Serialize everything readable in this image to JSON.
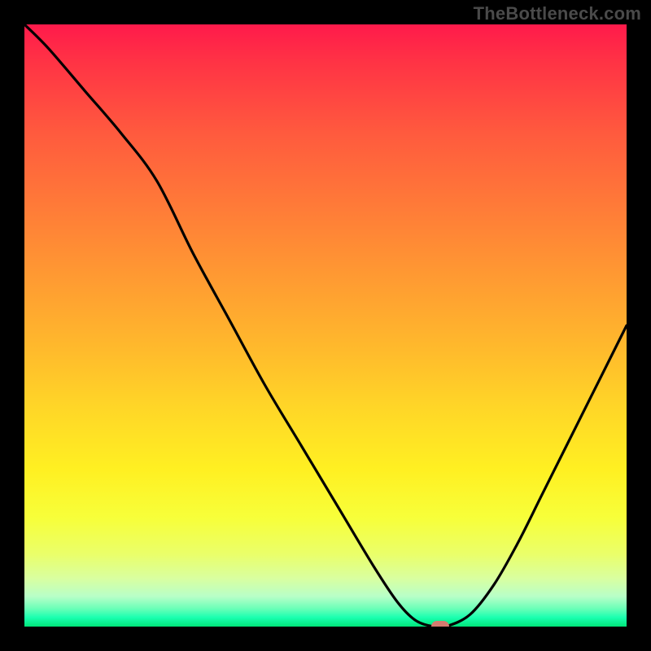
{
  "watermark": "TheBottleneck.com",
  "colors": {
    "frame_bg": "#000000",
    "marker": "#d47b70",
    "curve": "#000000",
    "gradient_top": "#ff1a4b",
    "gradient_bottom": "#00e57a"
  },
  "chart_data": {
    "type": "line",
    "title": "",
    "xlabel": "",
    "ylabel": "",
    "xlim": [
      0,
      100
    ],
    "ylim": [
      0,
      100
    ],
    "x": [
      0,
      4,
      10,
      16,
      22,
      28,
      34,
      40,
      46,
      52,
      58,
      62,
      65,
      68,
      70,
      74,
      78,
      82,
      86,
      90,
      94,
      98,
      100
    ],
    "values": [
      100,
      96,
      89,
      82,
      74,
      62,
      51,
      40,
      30,
      20,
      10,
      4,
      1,
      0,
      0,
      2,
      7,
      14,
      22,
      30,
      38,
      46,
      50
    ],
    "marker": {
      "x": 69,
      "y": 0
    },
    "note": "Values are percentages; 0 = bottom (green / no bottleneck), 100 = top (red / severe bottleneck). x-axis and y-axis have no visible tick labels in the source image, so values are estimated from geometry."
  }
}
